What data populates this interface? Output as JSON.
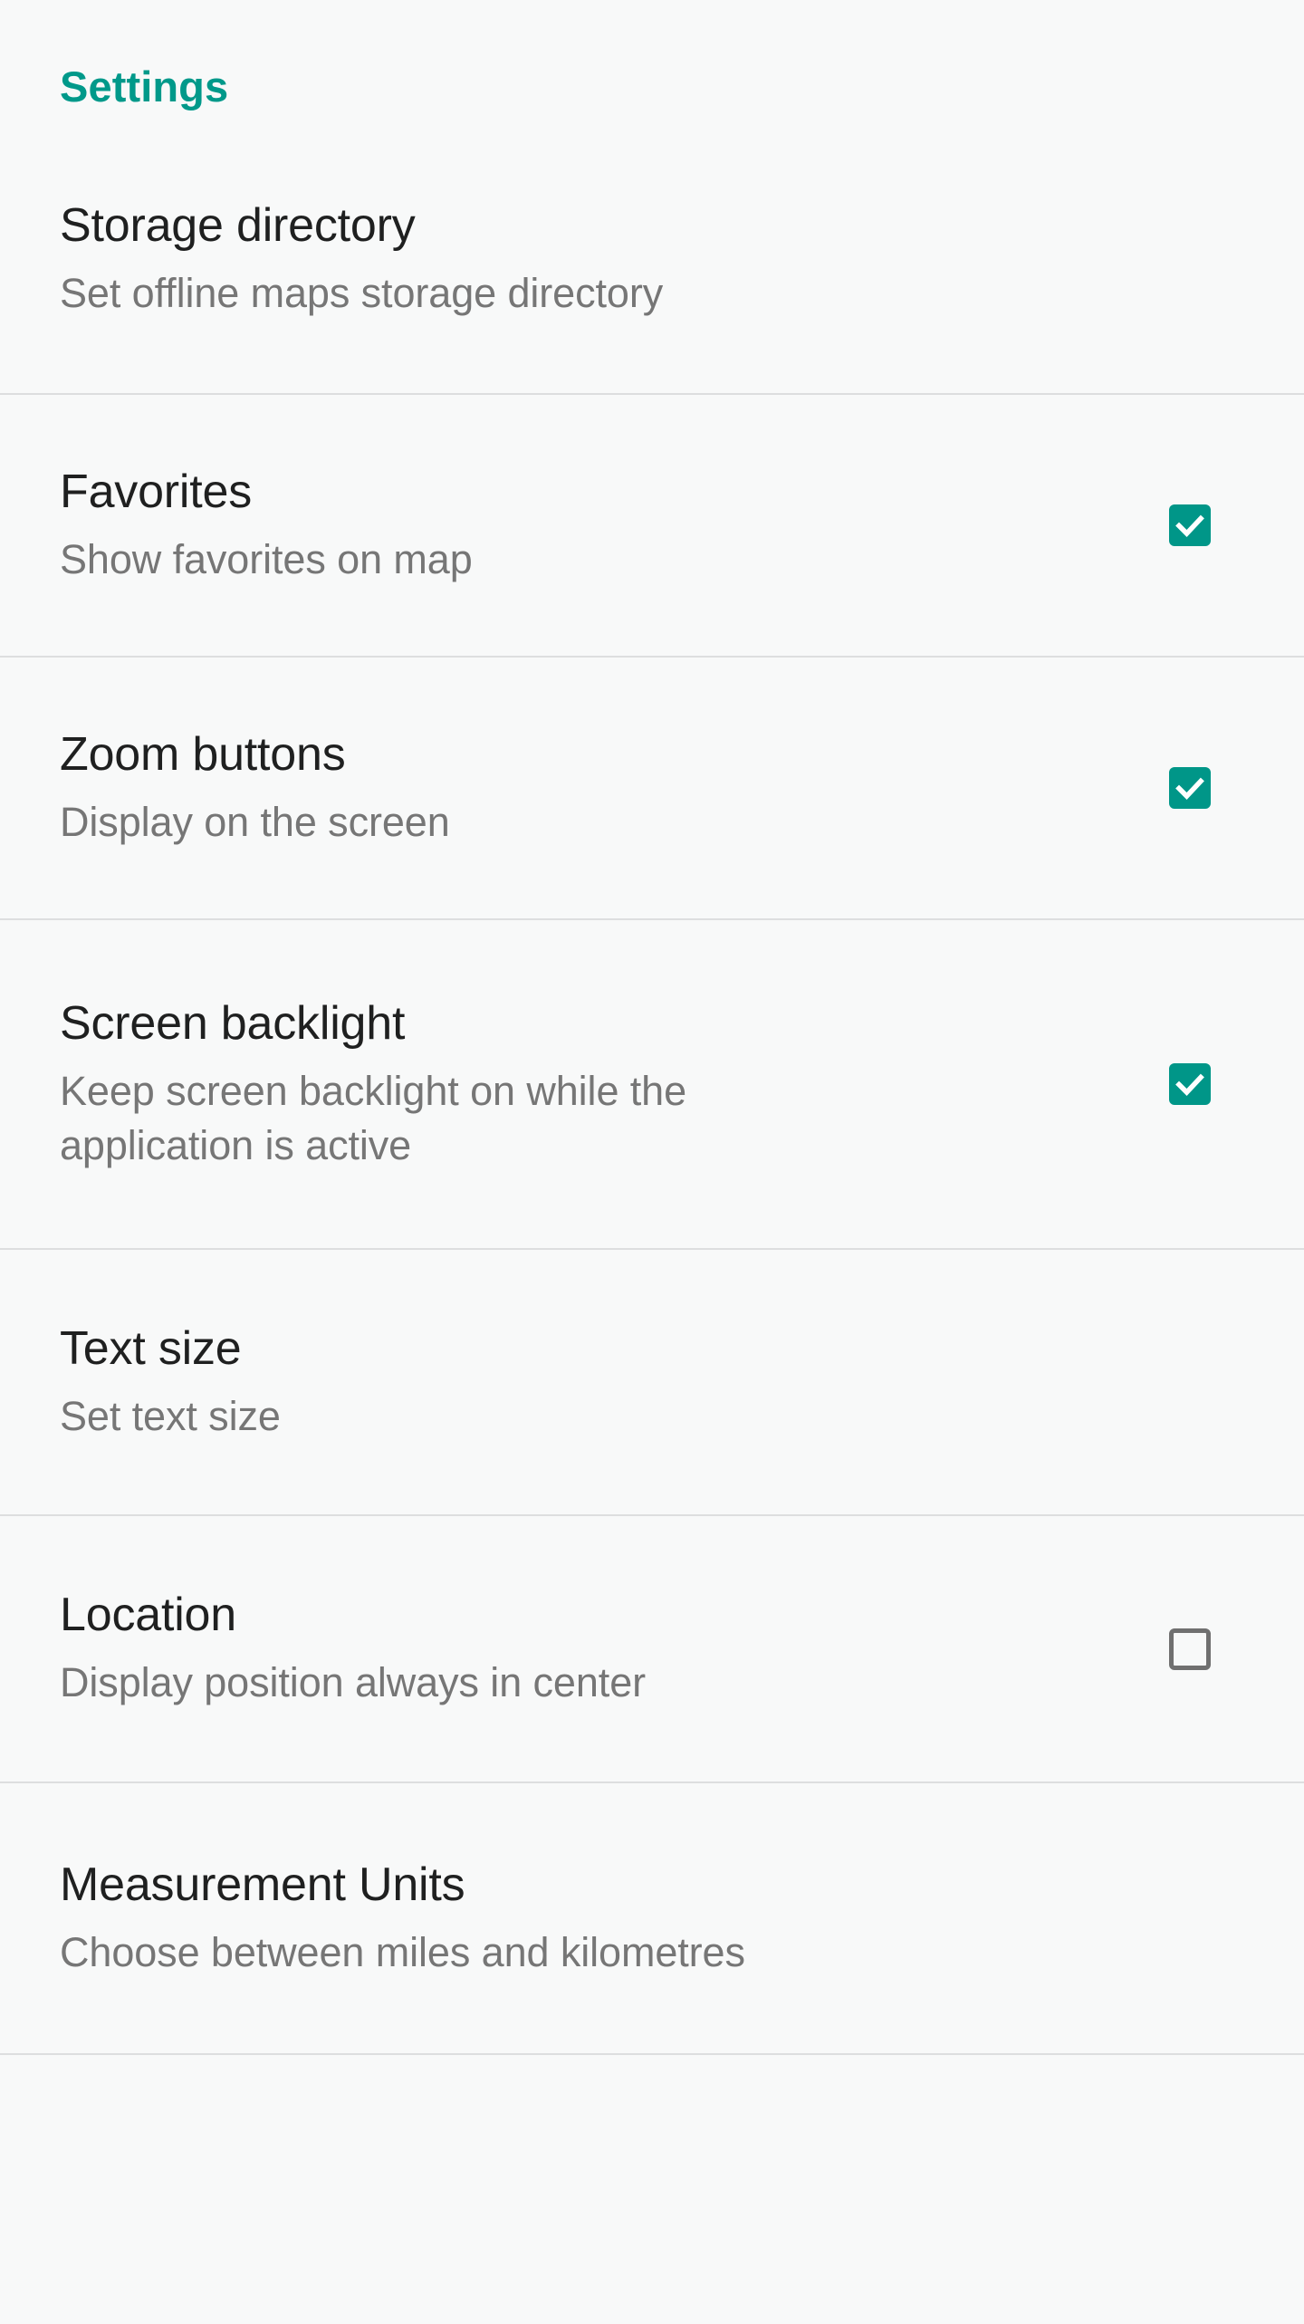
{
  "header": {
    "title": "Settings",
    "accent_color": "#00998a"
  },
  "theme": {
    "background": "#f8f9f9",
    "title_color": "#1f2020",
    "summary_color": "#767676",
    "divider_color": "#dddedf",
    "checkbox_checked_color": "#009688",
    "checkbox_unchecked_color": "#707070",
    "checkmark_color": "#ffffff"
  },
  "settings": {
    "items": [
      {
        "title": "Storage directory",
        "summary": "Set offline maps storage directory",
        "widget": "none",
        "checked": null
      },
      {
        "title": "Favorites",
        "summary": "Show favorites on map",
        "widget": "checkbox",
        "checked": true
      },
      {
        "title": "Zoom buttons",
        "summary": "Display on the screen",
        "widget": "checkbox",
        "checked": true
      },
      {
        "title": "Screen backlight",
        "summary": "Keep screen backlight on while the application is active",
        "widget": "checkbox",
        "checked": true
      },
      {
        "title": "Text size",
        "summary": "Set text size",
        "widget": "none",
        "checked": null
      },
      {
        "title": "Location",
        "summary": "Display position always in center",
        "widget": "checkbox",
        "checked": false
      },
      {
        "title": "Measurement Units",
        "summary": "Choose between miles and kilometres",
        "widget": "none",
        "checked": null
      }
    ]
  }
}
